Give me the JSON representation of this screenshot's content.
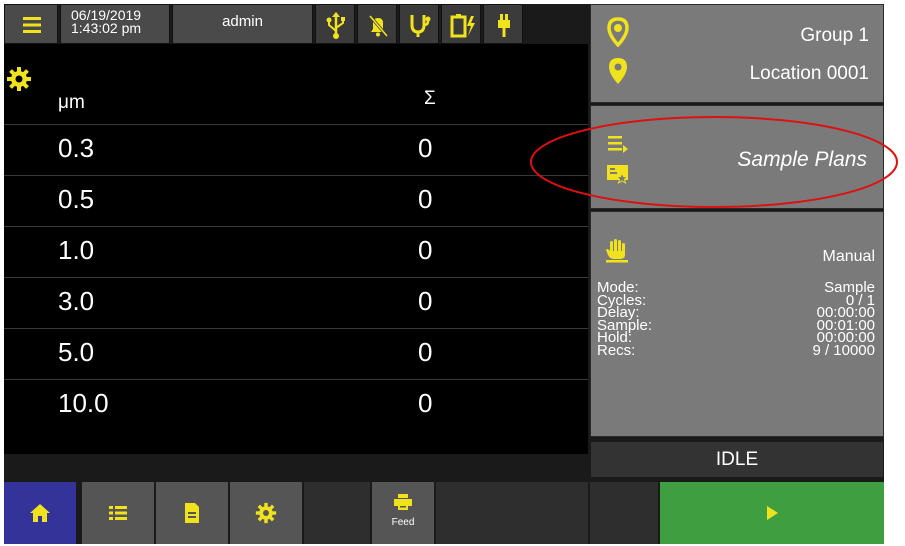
{
  "topbar": {
    "date": "06/19/2019",
    "time": "1:43:02 pm",
    "user": "admin",
    "icons": [
      "menu-icon",
      "usb-icon",
      "alarm-muted-icon",
      "sensor-icon",
      "battery-charging-icon",
      "plug-icon"
    ]
  },
  "table": {
    "col_size": "μm",
    "col_sum": "Σ",
    "rows": [
      {
        "size": "0.3",
        "count": "0"
      },
      {
        "size": "0.5",
        "count": "0"
      },
      {
        "size": "1.0",
        "count": "0"
      },
      {
        "size": "3.0",
        "count": "0"
      },
      {
        "size": "5.0",
        "count": "0"
      },
      {
        "size": "10.0",
        "count": "0"
      }
    ]
  },
  "location": {
    "group": "Group 1",
    "location": "Location 0001"
  },
  "sample_plans": {
    "label": "Sample Plans"
  },
  "status": {
    "mode_type": "Manual",
    "fields": [
      {
        "label": "Mode:",
        "value": "Sample"
      },
      {
        "label": "Cycles:",
        "value": "0 / 1"
      },
      {
        "label": "Delay:",
        "value": "00:00:00"
      },
      {
        "label": "Sample:",
        "value": "00:01:00"
      },
      {
        "label": "Hold:",
        "value": "00:00:00"
      },
      {
        "label": "Recs:",
        "value": "9 / 10000"
      }
    ],
    "state": "IDLE"
  },
  "bottombar": {
    "feed_label": "Feed"
  },
  "colors": {
    "accent_yellow": "#f0e21c",
    "home_active": "#33339a",
    "start_green": "#3f9e3f",
    "annotation_red": "#dd1111"
  }
}
